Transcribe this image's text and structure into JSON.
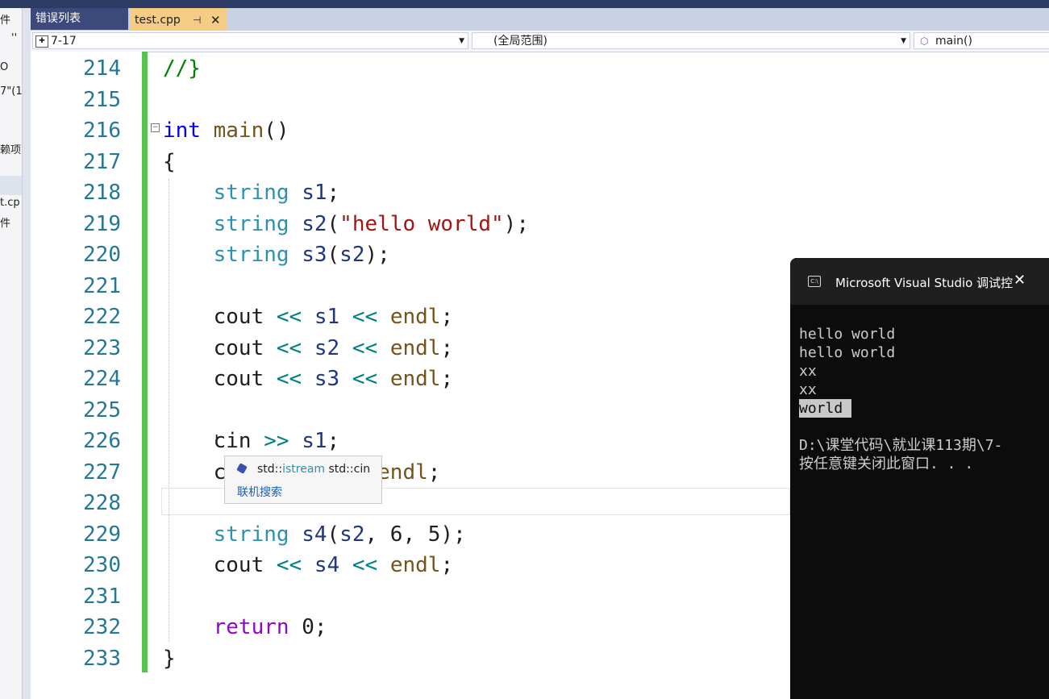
{
  "left_panel": {
    "fragments": [
      "件",
      "''",
      "O",
      "7\"(1",
      "赖项",
      "t.cp",
      "件"
    ]
  },
  "tabs": [
    {
      "label": "错误列表"
    },
    {
      "label": "test.cpp",
      "pin": "⊣",
      "close": "✕"
    }
  ],
  "navbar": {
    "project": "7-17",
    "scope": "(全局范围)",
    "member": "main()"
  },
  "code": {
    "line_numbers": [
      "214",
      "215",
      "216",
      "217",
      "218",
      "219",
      "220",
      "221",
      "222",
      "223",
      "224",
      "225",
      "226",
      "227",
      "228",
      "229",
      "230",
      "231",
      "232",
      "233"
    ],
    "lines": {
      "l214": "//}",
      "l216_kw": "int",
      "l216_fn": "main",
      "l216_rest": "()",
      "l217": "{",
      "l218_ty": "string",
      "l218_var": "s1",
      "l218_end": ";",
      "l219_ty": "string",
      "l219_var": "s2",
      "l219_open": "(",
      "l219_str": "\"hello world\"",
      "l219_end": ");",
      "l220_ty": "string",
      "l220_var": "s3",
      "l220_open": "(",
      "l220_arg": "s2",
      "l220_end": ");",
      "l222_a": "cout",
      "l222_op1": "<<",
      "l222_var": "s1",
      "l222_op2": "<<",
      "l222_fn": "endl",
      "l222_end": ";",
      "l223_a": "cout",
      "l223_op1": "<<",
      "l223_var": "s2",
      "l223_op2": "<<",
      "l223_fn": "endl",
      "l223_end": ";",
      "l224_a": "cout",
      "l224_op1": "<<",
      "l224_var": "s3",
      "l224_op2": "<<",
      "l224_fn": "endl",
      "l224_end": ";",
      "l226_a": "cin",
      "l226_op": ">>",
      "l226_var": "s1",
      "l226_end": ";",
      "l227_a": "c",
      "l227_op": "<<",
      "l227_fn": "endl",
      "l227_end": ";",
      "l229_ty": "string",
      "l229_var": "s4",
      "l229_open": "(",
      "l229_arg": "s2",
      "l229_sep1": ", ",
      "l229_n1": "6",
      "l229_sep2": ", ",
      "l229_n2": "5",
      "l229_end": ");",
      "l230_a": "cout",
      "l230_op1": "<<",
      "l230_var": "s4",
      "l230_op2": "<<",
      "l230_fn": "endl",
      "l230_end": ";",
      "l232_kw": "return",
      "l232_num": "0",
      "l232_end": ";",
      "l233": "}"
    }
  },
  "tooltip": {
    "sig_ns1": "std::",
    "sig_type": "istream",
    "sig_rest": " std::cin",
    "link": "联机搜索"
  },
  "console": {
    "title": "Microsoft Visual Studio 调试控",
    "close": "✕",
    "icon": "C:\\",
    "lines": [
      "hello world",
      "hello world",
      "xx",
      "xx",
      "world ",
      "",
      "D:\\课堂代码\\就业课113期\\7-",
      "按任意键关闭此窗口. . ."
    ]
  },
  "colors": {
    "line_number": "#237893",
    "keyword": "#0000ff",
    "type": "#2b91af",
    "string": "#a31515",
    "comment": "#008000",
    "tab_active": "#f5cc84",
    "change_bar": "#57c24d"
  }
}
